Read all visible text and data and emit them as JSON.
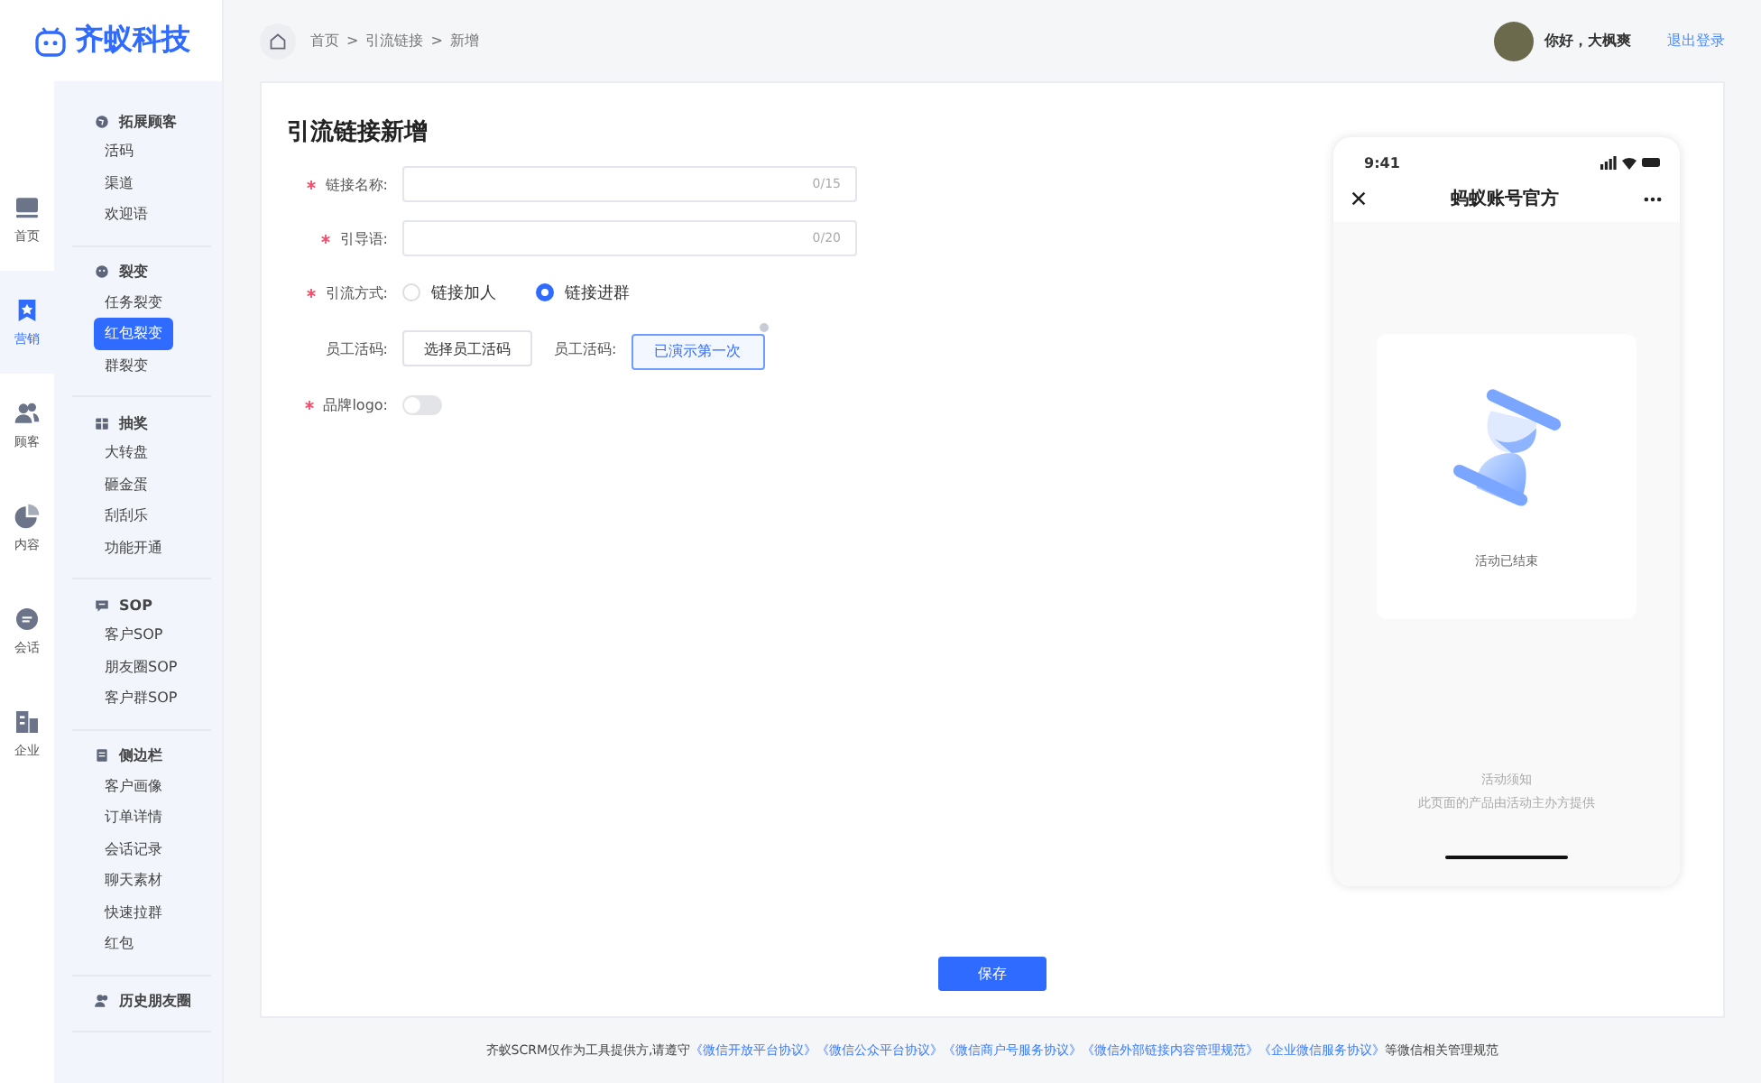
{
  "logo": {
    "text": "齐蚁科技"
  },
  "rail": [
    {
      "label": "首页",
      "selected": false
    },
    {
      "label": "营销",
      "selected": true
    },
    {
      "label": "顾客",
      "selected": false
    },
    {
      "label": "内容",
      "selected": false
    },
    {
      "label": "会话",
      "selected": false
    },
    {
      "label": "企业",
      "selected": false
    }
  ],
  "menu": [
    {
      "title": "拓展顾客",
      "items": [
        {
          "label": "活码",
          "selected": false
        },
        {
          "label": "渠道",
          "selected": false
        },
        {
          "label": "欢迎语",
          "selected": false
        }
      ]
    },
    {
      "title": "裂变",
      "items": [
        {
          "label": "任务裂变",
          "selected": false
        },
        {
          "label": "红包裂变",
          "selected": true
        },
        {
          "label": "群裂变",
          "selected": false
        }
      ]
    },
    {
      "title": "抽奖",
      "items": [
        {
          "label": "大转盘",
          "selected": false
        },
        {
          "label": "砸金蛋",
          "selected": false
        },
        {
          "label": "刮刮乐",
          "selected": false
        },
        {
          "label": "功能开通",
          "selected": false
        }
      ]
    },
    {
      "title": "SOP",
      "items": [
        {
          "label": "客户SOP",
          "selected": false
        },
        {
          "label": "朋友圈SOP",
          "selected": false
        },
        {
          "label": "客户群SOP",
          "selected": false
        }
      ]
    },
    {
      "title": "侧边栏",
      "items": [
        {
          "label": "客户画像",
          "selected": false
        },
        {
          "label": "订单详情",
          "selected": false
        },
        {
          "label": "会话记录",
          "selected": false
        },
        {
          "label": "聊天素材",
          "selected": false
        },
        {
          "label": "快速拉群",
          "selected": false
        },
        {
          "label": "红包",
          "selected": false
        }
      ]
    },
    {
      "title": "历史朋友圈"
    }
  ],
  "breadcrumb": [
    "首页",
    "引流链接",
    "新增"
  ],
  "breadcrumb_separator": ">",
  "user": {
    "greeting": "你好，大枫爽",
    "logout": "退出登录"
  },
  "form": {
    "title": "引流链接新增",
    "fields": [
      {
        "kind": "input",
        "label": "链接名称:",
        "required": true,
        "counter": "0/15"
      },
      {
        "kind": "input",
        "label": "引导语:",
        "required": true,
        "counter": "0/20"
      },
      {
        "kind": "radio",
        "label": "引流方式:",
        "required": true,
        "options": [
          {
            "label": "链接加人",
            "selected": false
          },
          {
            "label": "链接进群",
            "selected": true
          }
        ]
      },
      {
        "kind": "staff",
        "label": "员工活码:",
        "required": false,
        "button": "选择员工活码",
        "label2": "员工活码:",
        "chip": "已演示第一次"
      },
      {
        "kind": "switch",
        "label": "品牌logo:",
        "required": true,
        "on": false
      }
    ],
    "save": "保存"
  },
  "phone": {
    "time": "9:41",
    "title": "蚂蚁账号官方",
    "status": "活动已结束",
    "notice_title": "活动须知",
    "notice_text": "此页面的产品由活动主办方提供"
  },
  "footer": {
    "prefix": "齐蚁SCRM仅作为工具提供方,请遵守",
    "links": [
      "《微信开放平台协议》",
      "《微信公众平台协议》",
      "《微信商户号服务协议》",
      "《微信外部链接内容管理规范》",
      "《企业微信服务协议》"
    ],
    "suffix": "等微信相关管理规范"
  }
}
